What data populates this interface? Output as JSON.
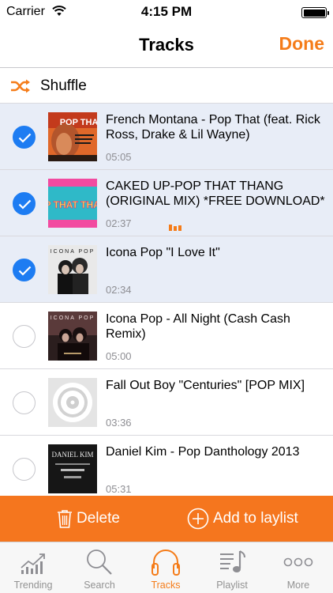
{
  "status_bar": {
    "carrier": "Carrier",
    "time": "4:15 PM"
  },
  "nav": {
    "title": "Tracks",
    "done_label": "Done"
  },
  "shuffle": {
    "label": "Shuffle",
    "icon": "shuffle-icon"
  },
  "tracks": [
    {
      "title": "French Montana - Pop That (feat. Rick Ross, Drake & Lil Wayne)",
      "duration": "05:05",
      "selected": true,
      "artwork_text": "POP THAT"
    },
    {
      "title": "CAKED UP-POP THAT THANG (ORIGINAL MIX) *FREE DOWNLOAD*",
      "duration": "02:37",
      "selected": true,
      "playing": true,
      "artwork_text": "POP THAT THANG"
    },
    {
      "title": "Icona Pop \"I Love It\"",
      "duration": "02:34",
      "selected": true,
      "artwork_text": "ICONA POP"
    },
    {
      "title": "Icona Pop - All Night (Cash Cash Remix)",
      "duration": "05:00",
      "selected": false,
      "artwork_text": "ICONA POP"
    },
    {
      "title": "Fall Out Boy \"Centuries\" [POP MIX]",
      "duration": "03:36",
      "selected": false,
      "artwork_text": ""
    },
    {
      "title": "Daniel Kim - Pop Danthology 2013",
      "duration": "05:31",
      "selected": false,
      "artwork_text": "DANIEL KIM"
    }
  ],
  "actions": {
    "delete_label": "Delete",
    "add_label": "Add to laylist"
  },
  "tabs": [
    {
      "label": "Trending",
      "icon": "trending-icon",
      "active": false
    },
    {
      "label": "Search",
      "icon": "search-icon",
      "active": false
    },
    {
      "label": "Tracks",
      "icon": "headphones-icon",
      "active": true
    },
    {
      "label": "Playlist",
      "icon": "playlist-icon",
      "active": false
    },
    {
      "label": "More",
      "icon": "more-icon",
      "active": false
    }
  ],
  "colors": {
    "accent": "#f57c19",
    "action_bar": "#f5761e",
    "selected_row": "#e8edf7",
    "check": "#1d7cf2"
  }
}
